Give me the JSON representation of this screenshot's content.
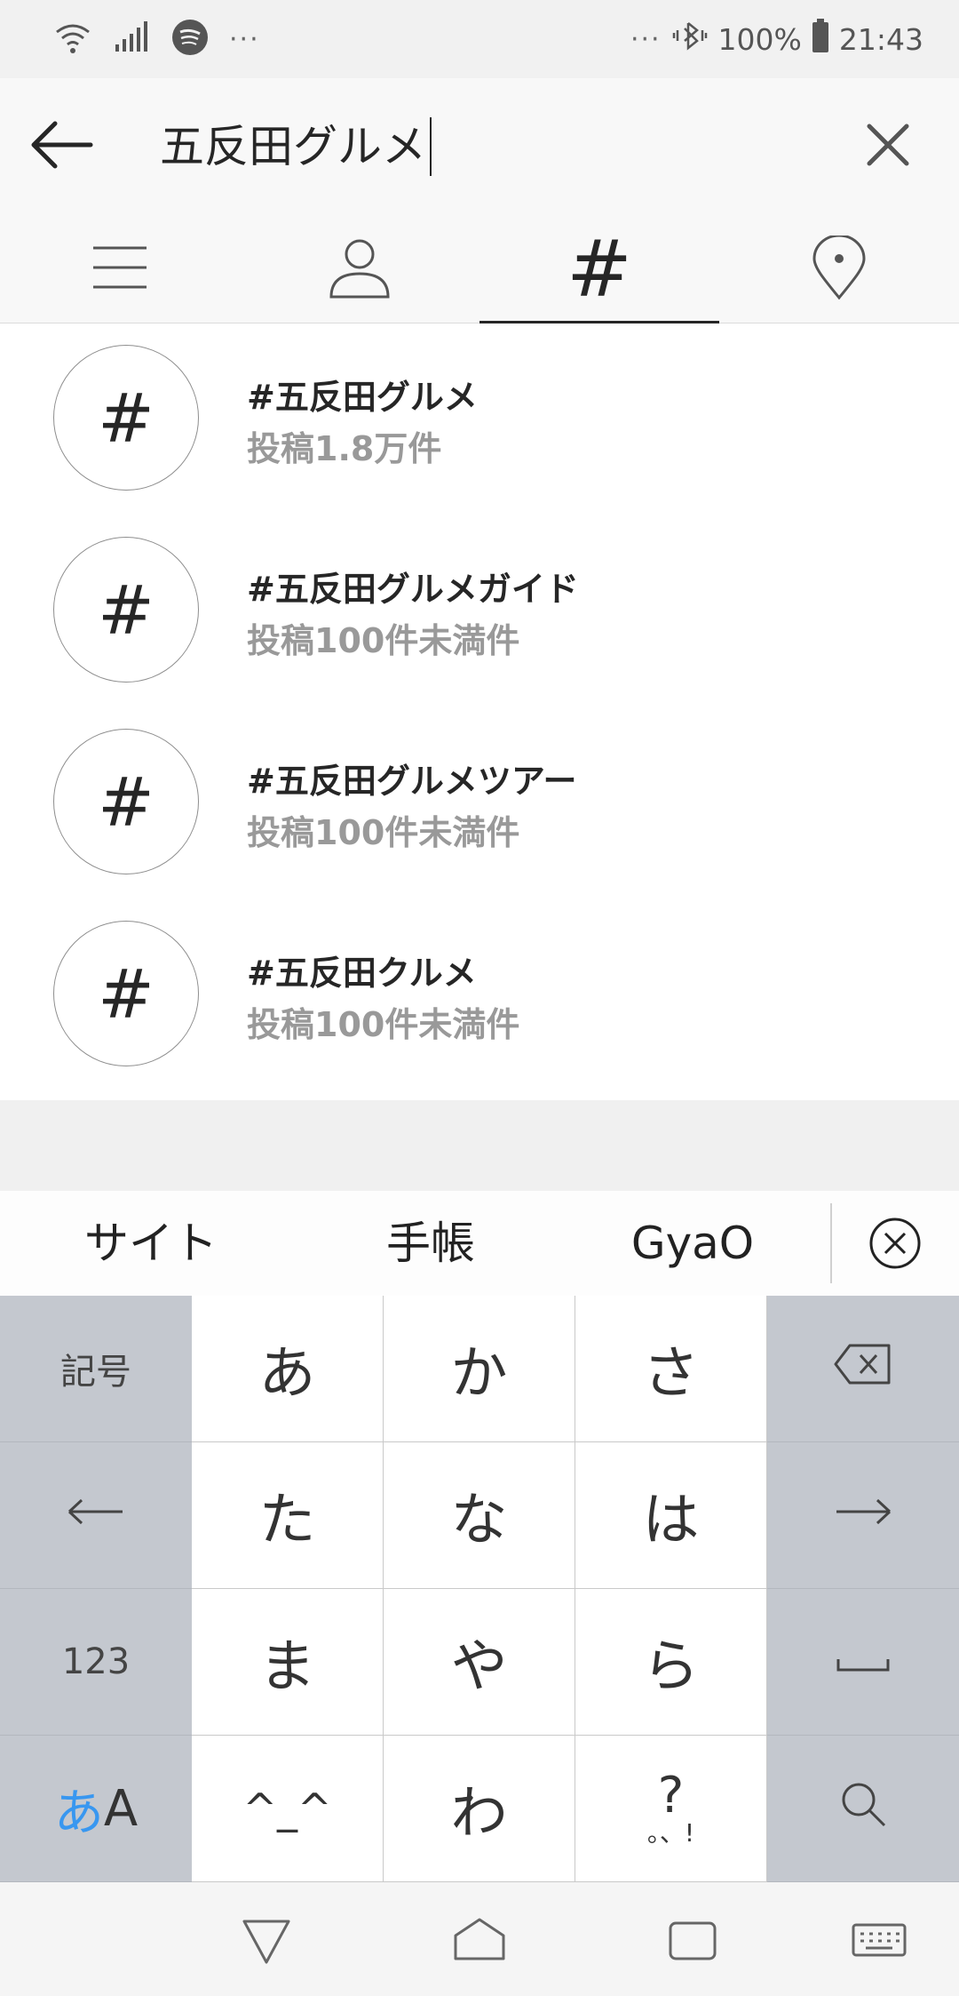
{
  "status_bar": {
    "left_more": "···",
    "right_more": "···",
    "battery": "100%",
    "time": "21:43",
    "icons": [
      "wifi-icon",
      "signal-icon",
      "spotify-icon",
      "vibrate-icon",
      "battery-icon"
    ]
  },
  "search": {
    "query": "五反田グルメ",
    "back_icon": "arrow-left-icon",
    "clear_icon": "close-icon"
  },
  "tabs": [
    {
      "name": "top",
      "icon": "menu-lines-icon"
    },
    {
      "name": "accounts",
      "icon": "person-icon"
    },
    {
      "name": "tags",
      "icon_text": "#",
      "active": true
    },
    {
      "name": "places",
      "icon": "location-pin-icon"
    }
  ],
  "results": [
    {
      "icon": "#",
      "title": "#五反田グルメ",
      "subtitle": "投稿1.8万件"
    },
    {
      "icon": "#",
      "title": "#五反田グルメガイド",
      "subtitle": "投稿100件未満件"
    },
    {
      "icon": "#",
      "title": "#五反田グルメツアー",
      "subtitle": "投稿100件未満件"
    },
    {
      "icon": "#",
      "title": "#五反田クルメ",
      "subtitle": "投稿100件未満件"
    }
  ],
  "suggestions": [
    "サイト",
    "手帳",
    "GyaO"
  ],
  "keyboard": {
    "rows": [
      [
        "記号",
        "あ",
        "か",
        "さ",
        "⌫"
      ],
      [
        "←",
        "た",
        "な",
        "は",
        "→"
      ],
      [
        "123",
        "ま",
        "や",
        "ら",
        "␣"
      ],
      [
        "あA",
        "^_^",
        "わ",
        "?!",
        "search"
      ]
    ],
    "mode_hiragana": "あ",
    "mode_latin": "A",
    "punct_main": "?",
    "punct_small": "。、!"
  },
  "colors": {
    "accent_blue": "#3897f0",
    "keyboard_gray": "#c4c8cf",
    "subtitle_gray": "#999999"
  }
}
